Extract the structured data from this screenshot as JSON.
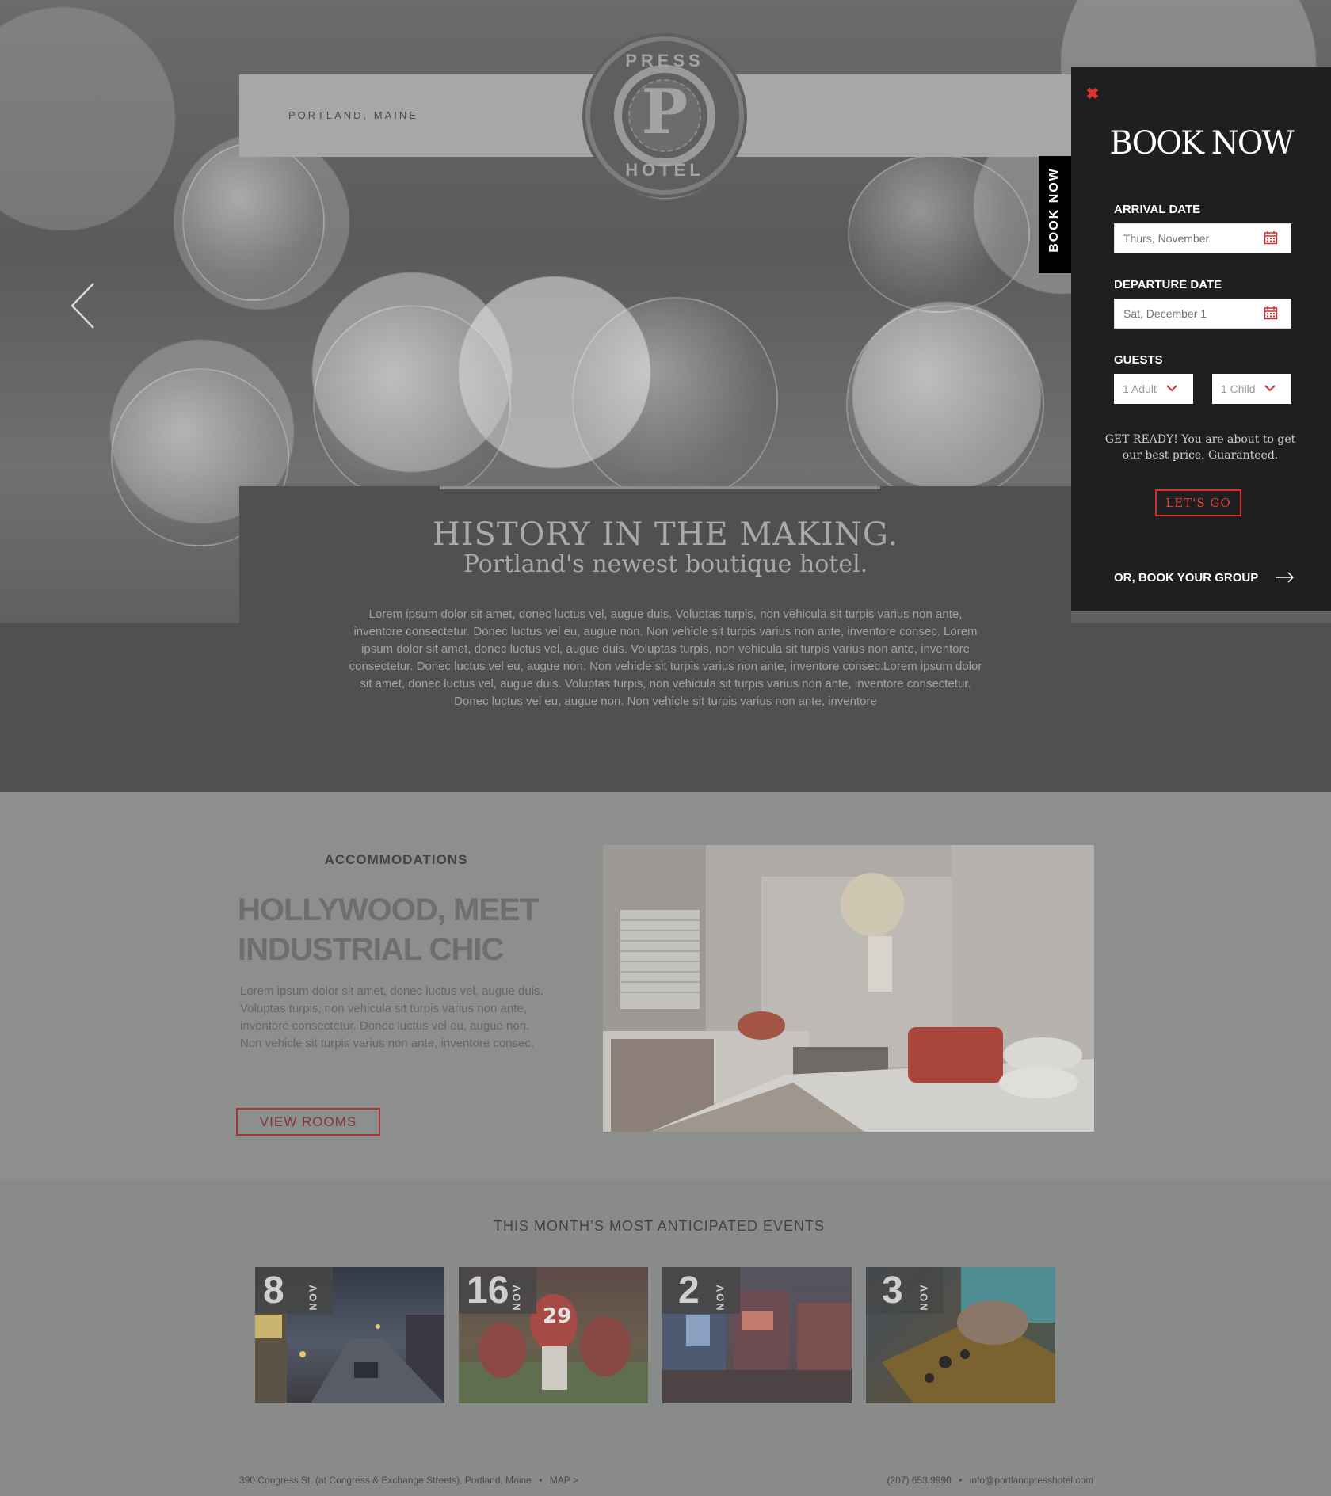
{
  "header": {
    "location": "PORTLAND, MAINE",
    "logo": {
      "top_text": "PRESS",
      "letter": "P",
      "bottom_text": "HOTEL"
    }
  },
  "hero": {
    "title": "HISTORY IN THE MAKING.",
    "subtitle": "Portland's newest boutique hotel.",
    "body": "Lorem ipsum dolor sit amet, donec luctus vel, augue duis. Voluptas turpis, non vehicula sit turpis varius non ante, inventore consectetur. Donec luctus vel eu, augue non. Non vehicle sit turpis varius non ante, inventore consec. Lorem ipsum dolor sit amet, donec luctus vel, augue duis. Voluptas turpis, non vehicula sit turpis varius non ante, inventore consectetur. Donec luctus vel eu, augue non. Non vehicle sit turpis varius non ante, inventore consec.Lorem ipsum dolor sit amet, donec luctus vel, augue duis. Voluptas turpis, non vehicula sit turpis varius non ante, inventore consectetur. Donec luctus vel eu, augue non. Non vehicle sit turpis varius non ante, inventore"
  },
  "accommodations": {
    "eyebrow": "ACCOMMODATIONS",
    "title": "HOLLYWOOD, MEET INDUSTRIAL CHIC",
    "body": "Lorem ipsum dolor sit amet, donec luctus vel, augue duis. Voluptas turpis, non vehicula sit turpis varius non ante, inventore consectetur. Donec luctus vel eu, augue non. Non vehicle sit turpis varius non ante, inventore consec.",
    "button": "VIEW ROOMS"
  },
  "events": {
    "title": "THIS MONTH’S MOST ANTICIPATED EVENTS",
    "items": [
      {
        "day": "8",
        "month": "NOV"
      },
      {
        "day": "16",
        "month": "NOV"
      },
      {
        "day": "2",
        "month": "NOV"
      },
      {
        "day": "3",
        "month": "NOV"
      }
    ]
  },
  "footer": {
    "address": "390 Congress St. (at Congress & Exchange Streets), Portland, Maine",
    "separator": "•",
    "map_link": "MAP >",
    "phone": "(207) 653.9990",
    "email": "info@portlandpresshotel.com"
  },
  "booking": {
    "tab_label": "BOOK NOW",
    "close_glyph": "✖",
    "title": "BOOK NOW",
    "arrival_label": "ARRIVAL DATE",
    "arrival_placeholder": "Thurs, November",
    "departure_label": "DEPARTURE DATE",
    "departure_placeholder": "Sat, December 1",
    "guests_label": "GUESTS",
    "adults_value": "1 Adult",
    "children_value": "1 Child",
    "promo": "GET READY! You are about to get our best price. Guaranteed.",
    "submit": "LET'S GO",
    "group_link": "OR, BOOK YOUR GROUP",
    "accent_color": "#d32f2f"
  }
}
